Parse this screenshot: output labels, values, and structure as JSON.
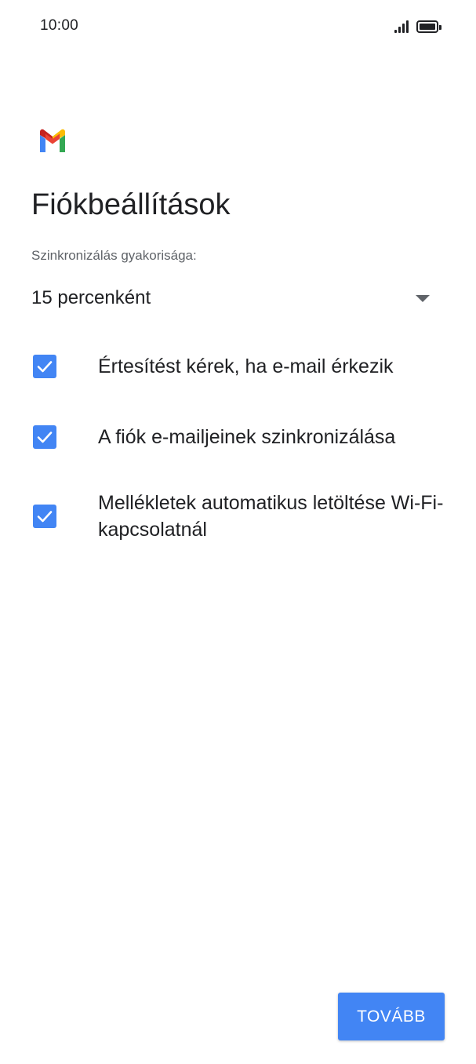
{
  "status_bar": {
    "time": "10:00",
    "signal_icon": "signal-bars-icon",
    "battery_icon": "battery-full-icon"
  },
  "app": {
    "logo": "gmail-logo-icon"
  },
  "page": {
    "title": "Fiókbeállítások"
  },
  "sync": {
    "label": "Szinkronizálás gyakorisága:",
    "selected_value": "15 percenként"
  },
  "options": [
    {
      "label": "Értesítést kérek, ha e-mail érkezik",
      "checked": true
    },
    {
      "label": "A fiók e-mailjeinek szinkronizálása",
      "checked": true
    },
    {
      "label": "Mellékletek automatikus letöltése Wi-Fi-kapcsolatnál",
      "checked": true
    }
  ],
  "footer": {
    "next_label": "TOVÁBB"
  },
  "colors": {
    "accent": "#4285f4",
    "text_primary": "#202124",
    "text_secondary": "#5f6368"
  }
}
